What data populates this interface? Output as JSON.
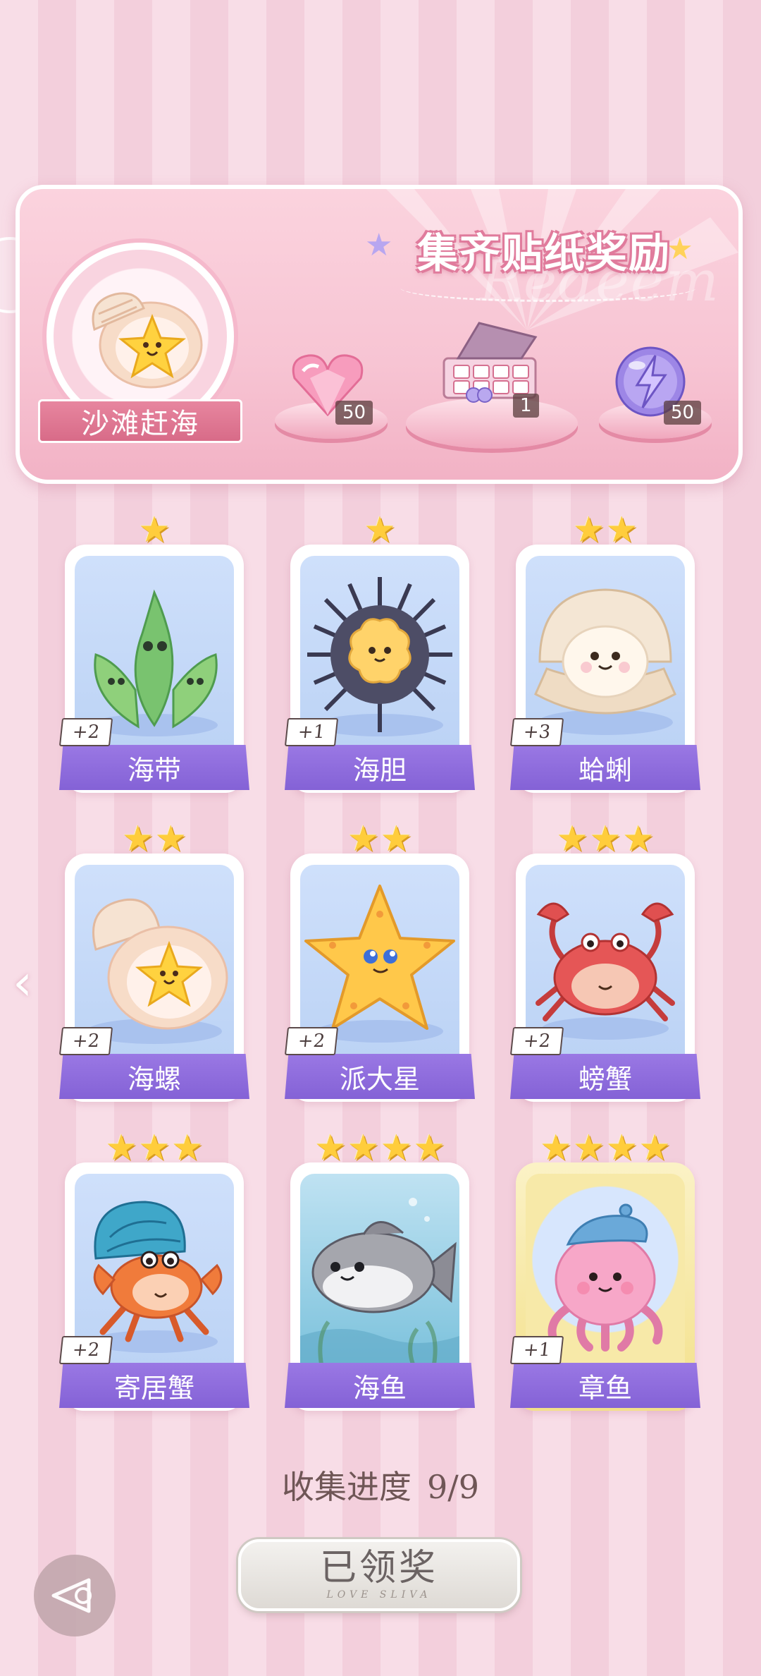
{
  "banner": {
    "title": "集齐贴纸奖励",
    "bg_word": "Redeem",
    "theme_name": "沙滩赶海",
    "rewards": [
      {
        "name": "heart-gem",
        "qty": "50"
      },
      {
        "name": "gift-box",
        "qty": "1"
      },
      {
        "name": "lightning-orb",
        "qty": "50"
      }
    ]
  },
  "cards": [
    {
      "name": "海带",
      "bonus": "+2",
      "stars": 1,
      "art": "seaweed"
    },
    {
      "name": "海胆",
      "bonus": "+1",
      "stars": 1,
      "art": "urchin"
    },
    {
      "name": "蛤蜊",
      "bonus": "+3",
      "stars": 2,
      "art": "clam"
    },
    {
      "name": "海螺",
      "bonus": "+2",
      "stars": 2,
      "art": "conch"
    },
    {
      "name": "派大星",
      "bonus": "+2",
      "stars": 2,
      "art": "starfish"
    },
    {
      "name": "螃蟹",
      "bonus": "+2",
      "stars": 3,
      "art": "crab"
    },
    {
      "name": "寄居蟹",
      "bonus": "+2",
      "stars": 3,
      "art": "hermit-crab"
    },
    {
      "name": "海鱼",
      "bonus": "",
      "stars": 4,
      "art": "fish"
    },
    {
      "name": "章鱼",
      "bonus": "+1",
      "stars": 4,
      "art": "octopus",
      "gold": true
    }
  ],
  "progress": {
    "label": "收集进度",
    "value": "9/9"
  },
  "claim_button": {
    "label": "已领奖",
    "sub": "LOVE SLIVA"
  },
  "colors": {
    "label_purple": "#8a68d9",
    "banner_pink": "#f7c4d3",
    "star_gold": "#ffcd3c"
  }
}
